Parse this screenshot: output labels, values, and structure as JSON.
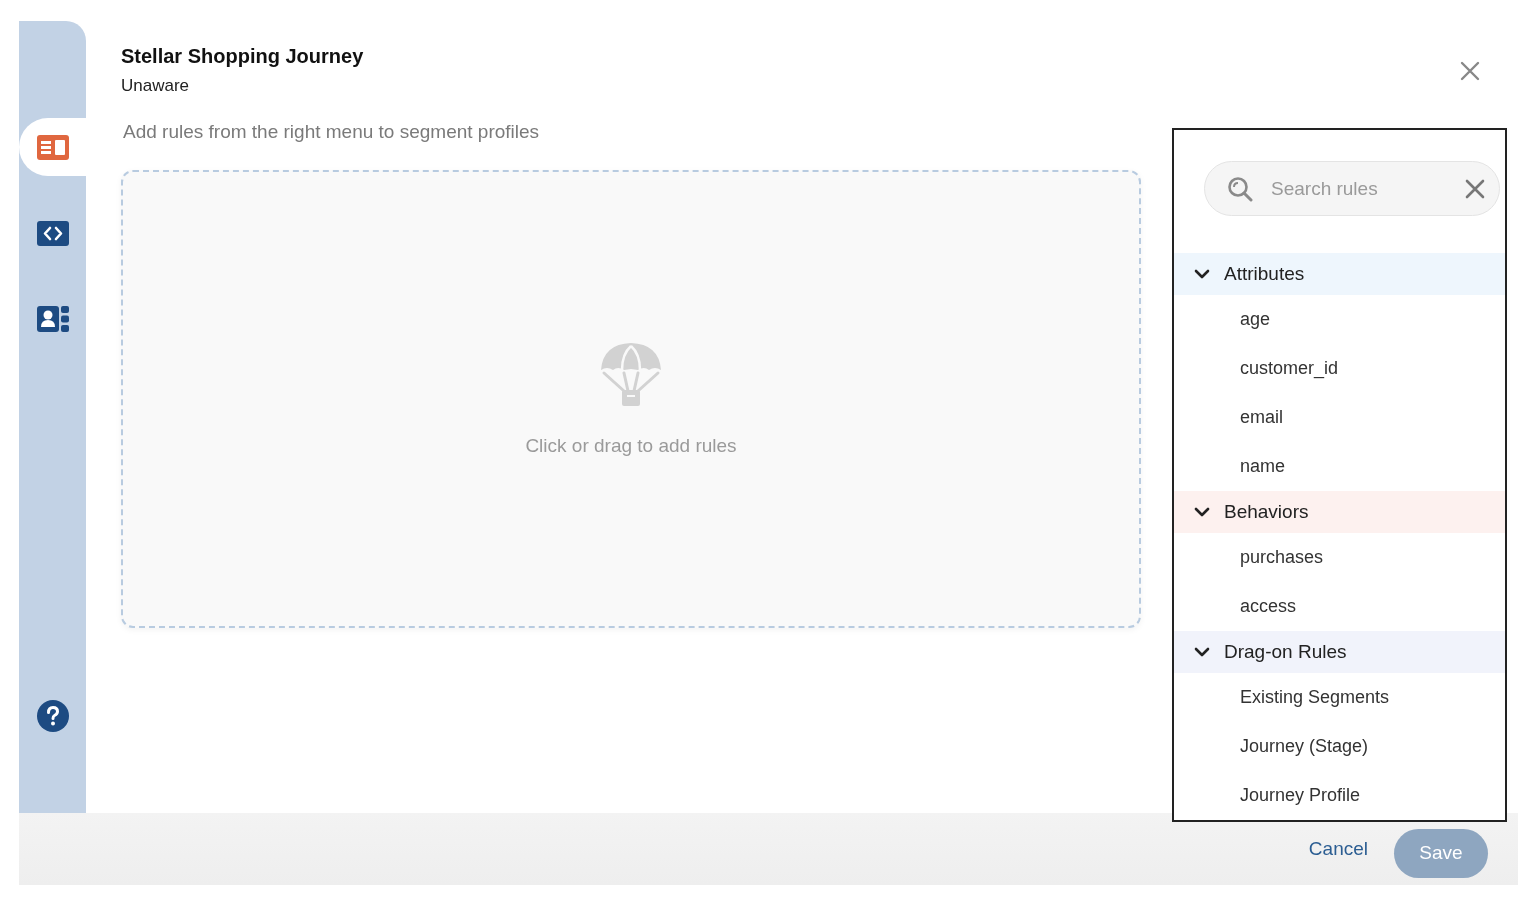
{
  "window": {
    "title": "Stellar Shopping Journey",
    "subtitle": "Unaware"
  },
  "sidebar": {
    "tabs": [
      {
        "selected": true
      },
      {
        "selected": false
      },
      {
        "selected": false
      }
    ]
  },
  "instructions": "Add rules from the right menu to segment profiles",
  "drop_zone": {
    "hint": "Click or drag to add rules"
  },
  "rules_panel": {
    "search": {
      "placeholder": "Search rules"
    },
    "groups": [
      {
        "label": "Attributes",
        "expanded": true,
        "color": "#eef6fd",
        "children": [
          {
            "label": "age"
          },
          {
            "label": "customer_id"
          },
          {
            "label": "email"
          },
          {
            "label": "name"
          }
        ]
      },
      {
        "label": "Behaviors",
        "expanded": true,
        "color": "#fdf1ef",
        "children": [
          {
            "label": "purchases"
          },
          {
            "label": "access"
          }
        ]
      },
      {
        "label": "Drag-on Rules",
        "expanded": true,
        "color": "#f1f3fb",
        "children": [
          {
            "label": "Existing Segments"
          },
          {
            "label": "Journey (Stage)"
          },
          {
            "label": "Journey Profile"
          }
        ]
      }
    ]
  },
  "footer": {
    "buttons": [
      {
        "label": "Cancel",
        "kind": "link",
        "disabled": false
      },
      {
        "label": "Save",
        "kind": "primary",
        "disabled": true
      }
    ]
  }
}
